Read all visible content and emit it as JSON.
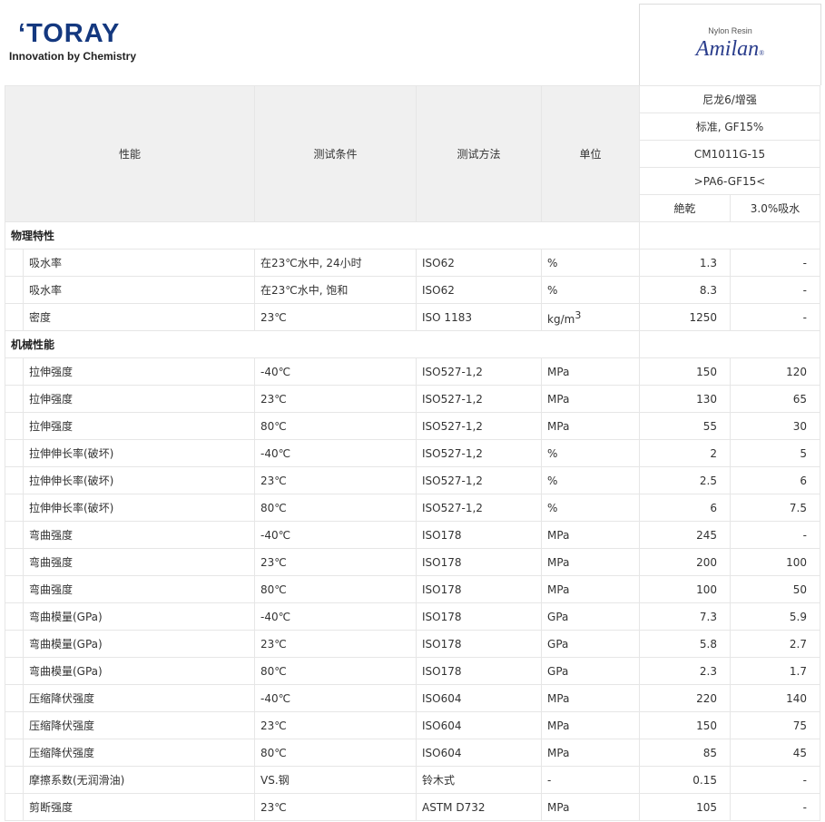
{
  "header": {
    "logo_text": "TORAY",
    "logo_tagline": "Innovation by Chemistry",
    "brand_sub": "Nylon Resin",
    "brand_name": "Amilan"
  },
  "columns": {
    "property": "性能",
    "condition": "测试条件",
    "method": "测试方法",
    "unit": "单位"
  },
  "grade": {
    "material": "尼龙6/增强",
    "type": "标准, GF15%",
    "code": "CM1011G-15",
    "marking": ">PA6-GF15<",
    "col_dry": "絶乾",
    "col_wet": "3.0%吸水"
  },
  "sections": [
    {
      "title": "物理特性",
      "rows": [
        {
          "property": "吸水率",
          "condition": "在23℃水中, 24小时",
          "method": "ISO62",
          "unit": "%",
          "dry": "1.3",
          "wet": "-"
        },
        {
          "property": "吸水率",
          "condition": "在23℃水中, 饱和",
          "method": "ISO62",
          "unit": "%",
          "dry": "8.3",
          "wet": "-"
        },
        {
          "property": "密度",
          "condition": "23℃",
          "method": "ISO 1183",
          "unit": "kg/m3",
          "dry": "1250",
          "wet": "-"
        }
      ]
    },
    {
      "title": "机械性能",
      "rows": [
        {
          "property": "拉伸强度",
          "condition": "-40℃",
          "method": "ISO527-1,2",
          "unit": "MPa",
          "dry": "150",
          "wet": "120"
        },
        {
          "property": "拉伸强度",
          "condition": "23℃",
          "method": "ISO527-1,2",
          "unit": "MPa",
          "dry": "130",
          "wet": "65"
        },
        {
          "property": "拉伸强度",
          "condition": "80℃",
          "method": "ISO527-1,2",
          "unit": "MPa",
          "dry": "55",
          "wet": "30"
        },
        {
          "property": "拉伸伸长率(破坏)",
          "condition": "-40℃",
          "method": "ISO527-1,2",
          "unit": "%",
          "dry": "2",
          "wet": "5"
        },
        {
          "property": "拉伸伸长率(破坏)",
          "condition": "23℃",
          "method": "ISO527-1,2",
          "unit": "%",
          "dry": "2.5",
          "wet": "6"
        },
        {
          "property": "拉伸伸长率(破坏)",
          "condition": "80℃",
          "method": "ISO527-1,2",
          "unit": "%",
          "dry": "6",
          "wet": "7.5"
        },
        {
          "property": "弯曲强度",
          "condition": "-40℃",
          "method": "ISO178",
          "unit": "MPa",
          "dry": "245",
          "wet": "-"
        },
        {
          "property": "弯曲强度",
          "condition": "23℃",
          "method": "ISO178",
          "unit": "MPa",
          "dry": "200",
          "wet": "100"
        },
        {
          "property": "弯曲强度",
          "condition": "80℃",
          "method": "ISO178",
          "unit": "MPa",
          "dry": "100",
          "wet": "50"
        },
        {
          "property": "弯曲模量(GPa)",
          "condition": "-40℃",
          "method": "ISO178",
          "unit": "GPa",
          "dry": "7.3",
          "wet": "5.9"
        },
        {
          "property": "弯曲模量(GPa)",
          "condition": "23℃",
          "method": "ISO178",
          "unit": "GPa",
          "dry": "5.8",
          "wet": "2.7"
        },
        {
          "property": "弯曲模量(GPa)",
          "condition": "80℃",
          "method": "ISO178",
          "unit": "GPa",
          "dry": "2.3",
          "wet": "1.7"
        },
        {
          "property": "压缩降伏强度",
          "condition": "-40℃",
          "method": "ISO604",
          "unit": "MPa",
          "dry": "220",
          "wet": "140"
        },
        {
          "property": "压缩降伏强度",
          "condition": "23℃",
          "method": "ISO604",
          "unit": "MPa",
          "dry": "150",
          "wet": "75"
        },
        {
          "property": "压缩降伏强度",
          "condition": "80℃",
          "method": "ISO604",
          "unit": "MPa",
          "dry": "85",
          "wet": "45"
        },
        {
          "property": "摩擦系数(无润滑油)",
          "condition": "VS.钢",
          "method": "铃木式",
          "unit": "-",
          "dry": "0.15",
          "wet": "-"
        },
        {
          "property": "剪断强度",
          "condition": "23℃",
          "method": "ASTM D732",
          "unit": "MPa",
          "dry": "105",
          "wet": "-"
        }
      ]
    }
  ]
}
